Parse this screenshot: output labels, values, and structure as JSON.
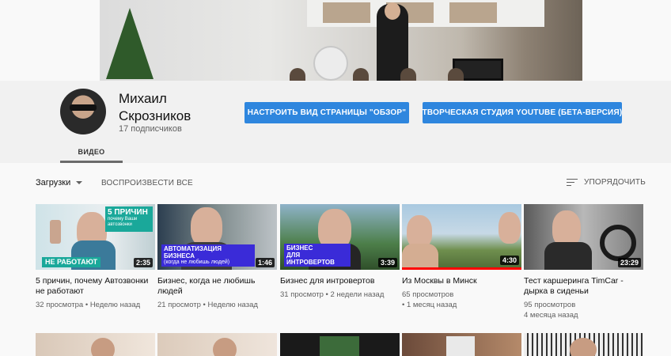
{
  "channel": {
    "name": "Михаил Скрозников",
    "subscribers": "17 подписчиков",
    "customize_label": "НАСТРОИТЬ ВИД СТРАНИЦЫ \"ОБЗОР\"",
    "studio_label": "ТВОРЧЕСКАЯ СТУДИЯ YOUTUBE (БЕТА-ВЕРСИЯ)"
  },
  "tabs": [
    {
      "label": "ВИДЕО"
    }
  ],
  "toolbar": {
    "uploads_label": "Загрузки",
    "play_all_label": "ВОСПРОИЗВЕСТИ ВСЕ",
    "sort_label": "УПОРЯДОЧИТЬ"
  },
  "videos": [
    {
      "title": "5 причин, почему Автозвонки не работают",
      "views": "32 просмотра",
      "age": "Неделю назад",
      "duration": "2:35",
      "watched": 0.0,
      "overlay_top": "5 ПРИЧИН",
      "overlay_top_sub": "почему Ваши автозвонки",
      "overlay_bottom": "НЕ РАБОТАЮТ"
    },
    {
      "title": "Бизнес, когда не любишь людей",
      "views": "21 просмотр",
      "age": "Неделю назад",
      "duration": "1:46",
      "watched": 0.0,
      "overlay_bottom": "АВТОМАТИЗАЦИЯ БИЗНЕСА",
      "overlay_bottom_sub": "(когда не любишь людей)"
    },
    {
      "title": "Бизнес для интровертов",
      "views": "31 просмотр",
      "age": "2 недели назад",
      "duration": "3:39",
      "watched": 0.0,
      "overlay_bottom": "БИЗНЕС",
      "overlay_bottom_sub": "ДЛЯ ИНТРОВЕРТОВ"
    },
    {
      "title": "Из Москвы в Минск",
      "views": "65 просмотров",
      "age": "1 месяц назад",
      "duration": "4:30",
      "watched": 1.0
    },
    {
      "title": "Тест каршеринга TimCar - дырка в сиденьи",
      "views": "95 просмотров",
      "age": "4 месяца назад",
      "duration": "23:29",
      "watched": 0.0
    }
  ],
  "icons": {
    "sort": "sort-icon",
    "caret": "caret-down-icon"
  },
  "colors": {
    "primary_button": "#2e86de",
    "progress": "#ff0000",
    "thumb_accent_green": "#1aa89a",
    "thumb_accent_blue": "#3a2bd8"
  }
}
